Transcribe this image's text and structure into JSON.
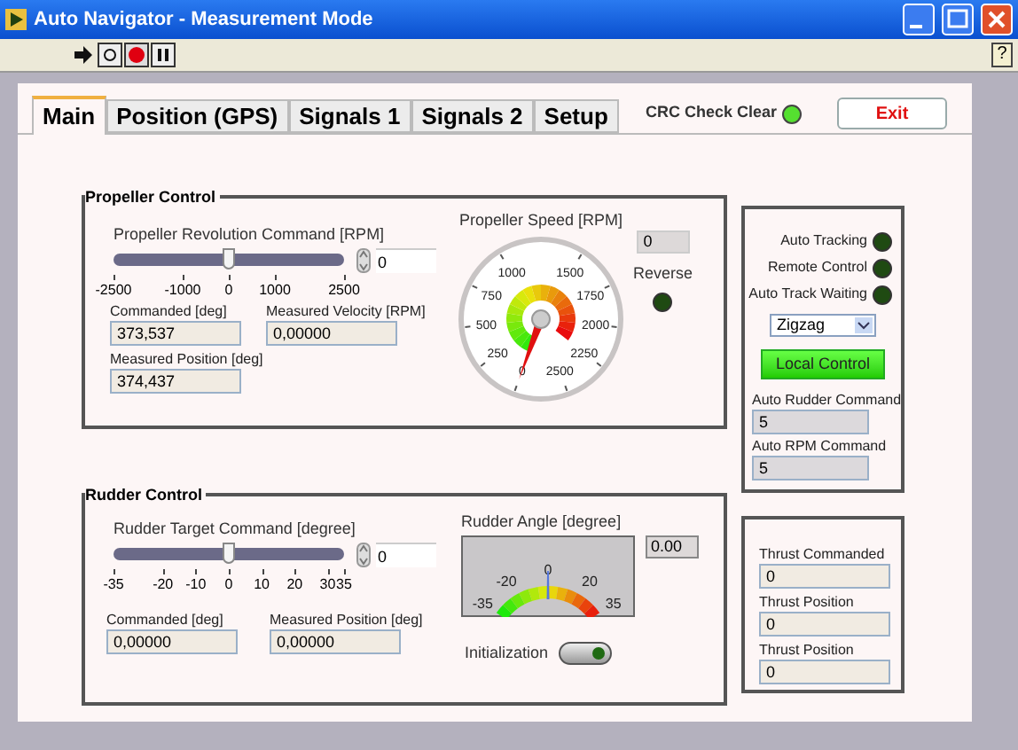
{
  "window": {
    "title": "Auto Navigator - Measurement Mode"
  },
  "help_button": "?",
  "tabs": [
    {
      "label": "Main",
      "selected": true
    },
    {
      "label": "Position (GPS)",
      "selected": false
    },
    {
      "label": "Signals 1",
      "selected": false
    },
    {
      "label": "Signals 2",
      "selected": false
    },
    {
      "label": "Setup",
      "selected": false
    }
  ],
  "crc_indicator": {
    "label": "CRC Check Clear",
    "on": true
  },
  "exit_button": "Exit",
  "propeller_control": {
    "title": "Propeller Control",
    "command": {
      "label": "Propeller Revolution Command [RPM]",
      "level": 0.5,
      "value": "0",
      "ticks": [
        "-2500",
        "-1000",
        "0",
        "1000",
        "2500"
      ]
    },
    "fields": [
      {
        "label": "Commanded [deg]",
        "value": "373,537"
      },
      {
        "label": "Measured Velocity [RPM]",
        "value": "0,00000"
      },
      {
        "label": "Measured Position [deg]",
        "value": "374,437"
      }
    ],
    "speed_gauge": {
      "label": "Propeller Speed [RPM]",
      "ticks": [
        "0",
        "250",
        "500",
        "750",
        "1000",
        "1500",
        "1750",
        "2000",
        "2250",
        "2500"
      ],
      "reading": "0"
    },
    "reverse": {
      "label": "Reverse",
      "on": false
    }
  },
  "status_panel": {
    "indicators": [
      {
        "label": "Auto Tracking",
        "on": false
      },
      {
        "label": "Remote Control",
        "on": false
      },
      {
        "label": "Auto Track Waiting",
        "on": false
      }
    ],
    "mode_select": "Zigzag",
    "local_control_button": "Local Control",
    "fields": [
      {
        "label": "Auto Rudder Command",
        "value": "5"
      },
      {
        "label": "Auto RPM Command",
        "value": "5"
      }
    ]
  },
  "rudder_control": {
    "title": "Rudder Control",
    "command": {
      "label": "Rudder Target Command [degree]",
      "level": 0.5,
      "value": "0",
      "ticks": [
        "-35",
        "-20",
        "-10",
        "0",
        "10",
        "20",
        "30",
        "35"
      ]
    },
    "angle_meter": {
      "label": "Rudder Angle [degree]",
      "level": 0.5,
      "ticks": [
        "-35",
        "-20",
        "0",
        "20",
        "35"
      ],
      "reading": "0.00"
    },
    "fields": [
      {
        "label": "Commanded [deg]",
        "value": "0,00000"
      },
      {
        "label": "Measured Position [deg]",
        "value": "0,00000"
      }
    ],
    "initialization": {
      "label": "Initialization",
      "on": false
    }
  },
  "thrust_panel": {
    "fields": [
      {
        "label": "Thrust Commanded",
        "value": "0"
      },
      {
        "label": "Thrust Position",
        "value": "0"
      },
      {
        "label": "Thrust Position",
        "value": "0"
      }
    ]
  }
}
